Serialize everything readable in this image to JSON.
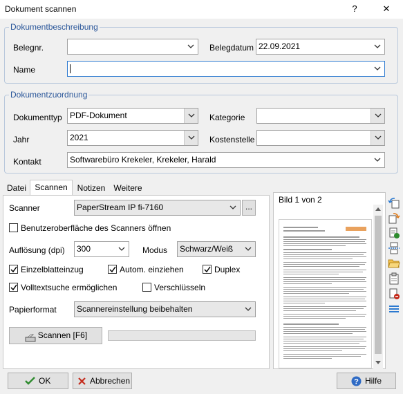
{
  "window": {
    "title": "Dokument scannen",
    "help_glyph": "?",
    "close_glyph": "✕"
  },
  "description_group": {
    "legend": "Dokumentbeschreibung",
    "belegnr_label": "Belegnr.",
    "belegnr_value": "",
    "belegdatum_label": "Belegdatum",
    "belegdatum_value": "22.09.2021",
    "name_label": "Name",
    "name_value": ""
  },
  "assignment_group": {
    "legend": "Dokumentzuordnung",
    "doctype_label": "Dokumenttyp",
    "doctype_value": "PDF-Dokument",
    "kategorie_label": "Kategorie",
    "kategorie_value": "",
    "jahr_label": "Jahr",
    "jahr_value": "2021",
    "kostenstelle_label": "Kostenstelle",
    "kostenstelle_value": "",
    "kontakt_label": "Kontakt",
    "kontakt_value": "Softwarebüro Krekeler, Krekeler, Harald"
  },
  "tabs": [
    "Datei",
    "Scannen",
    "Notizen",
    "Weitere"
  ],
  "scan_tab": {
    "scanner_label": "Scanner",
    "scanner_value": "PaperStream IP fi-7160",
    "browse_label": "...",
    "ui_checkbox_label": "Benutzeroberfläche des Scanners öffnen",
    "ui_checkbox_checked": false,
    "resolution_label": "Auflösung (dpi)",
    "resolution_value": "300",
    "mode_label": "Modus",
    "mode_value": "Schwarz/Weiß",
    "single_feed_label": "Einzelblatteinzug",
    "single_feed_checked": true,
    "auto_feed_label": "Autom. einziehen",
    "auto_feed_checked": true,
    "duplex_label": "Duplex",
    "duplex_checked": true,
    "fulltext_label": "Volltextsuche ermöglichen",
    "fulltext_checked": true,
    "encrypt_label": "Verschlüsseln",
    "encrypt_checked": false,
    "paper_label": "Papierformat",
    "paper_value": "Scannereinstellung beibehalten",
    "scan_button_label": "Scannen  [F6]",
    "progress": 0
  },
  "preview": {
    "page_label": "Bild 1 von 2"
  },
  "footer": {
    "ok_label": "OK",
    "cancel_label": "Abbrechen",
    "help_label": "Hilfe"
  },
  "colors": {
    "accent": "#2b579a",
    "ok_check": "#2e8b2e",
    "cancel_x": "#c42b1c",
    "help_circle": "#2f6bc5"
  }
}
